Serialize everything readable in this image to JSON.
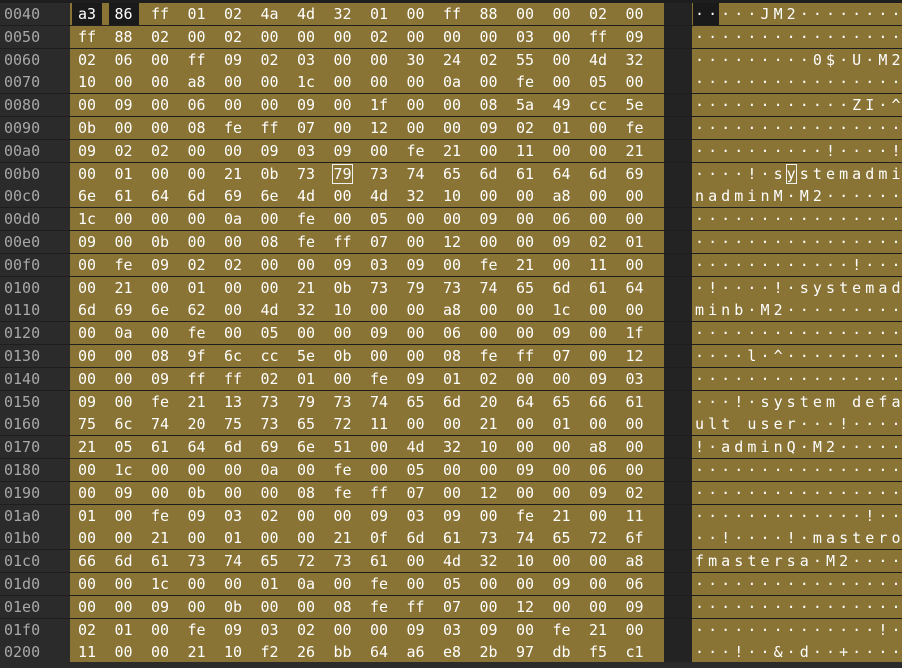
{
  "rows": [
    {
      "addr": "0040",
      "hex": "a3 86 ff 01 02 4a 4d 32 01 00 ff 88 00 00 02 00",
      "ascii": "·····JM2········"
    },
    {
      "addr": "0050",
      "hex": "ff 88 02 00 02 00 00 00 02 00 00 00 03 00 ff 09",
      "ascii": "················"
    },
    {
      "addr": "0060",
      "hex": "02 06 00 ff 09 02 03 00 00 30 24 02 55 00 4d 32",
      "ascii": "·········0$·U·M2"
    },
    {
      "addr": "0070",
      "hex": "10 00 00 a8 00 00 1c 00 00 00 0a 00 fe 00 05 00",
      "ascii": "················"
    },
    {
      "addr": "0080",
      "hex": "00 09 00 06 00 00 09 00 1f 00 00 08 5a 49 cc 5e",
      "ascii": "············ZI·^"
    },
    {
      "addr": "0090",
      "hex": "0b 00 00 08 fe ff 07 00 12 00 00 09 02 01 00 fe",
      "ascii": "················"
    },
    {
      "addr": "00a0",
      "hex": "09 02 02 00 00 09 03 09 00 fe 21 00 11 00 00 21",
      "ascii": "··········!····!"
    },
    {
      "addr": "00b0",
      "hex": "00 01 00 00 21 0b 73 79 73 74 65 6d 61 64 6d 69",
      "ascii": "····!·systemadmi"
    },
    {
      "addr": "00c0",
      "hex": "6e 61 64 6d 69 6e 4d 00 4d 32 10 00 00 a8 00 00",
      "ascii": "nadminM·M2······"
    },
    {
      "addr": "00d0",
      "hex": "1c 00 00 00 0a 00 fe 00 05 00 00 09 00 06 00 00",
      "ascii": "················"
    },
    {
      "addr": "00e0",
      "hex": "09 00 0b 00 00 08 fe ff 07 00 12 00 00 09 02 01",
      "ascii": "················"
    },
    {
      "addr": "00f0",
      "hex": "00 fe 09 02 02 00 00 09 03 09 00 fe 21 00 11 00",
      "ascii": "············!···"
    },
    {
      "addr": "0100",
      "hex": "00 21 00 01 00 00 21 0b 73 79 73 74 65 6d 61 64",
      "ascii": "·!····!·systemad"
    },
    {
      "addr": "0110",
      "hex": "6d 69 6e 62 00 4d 32 10 00 00 a8 00 00 1c 00 00",
      "ascii": "minb·M2·········"
    },
    {
      "addr": "0120",
      "hex": "00 0a 00 fe 00 05 00 00 09 00 06 00 00 09 00 1f",
      "ascii": "················"
    },
    {
      "addr": "0130",
      "hex": "00 00 08 9f 6c cc 5e 0b 00 00 08 fe ff 07 00 12",
      "ascii": "····l·^·········"
    },
    {
      "addr": "0140",
      "hex": "00 00 09 ff ff 02 01 00 fe 09 01 02 00 00 09 03",
      "ascii": "················"
    },
    {
      "addr": "0150",
      "hex": "09 00 fe 21 13 73 79 73 74 65 6d 20 64 65 66 61",
      "ascii": "···!·system defa"
    },
    {
      "addr": "0160",
      "hex": "75 6c 74 20 75 73 65 72 11 00 00 21 00 01 00 00",
      "ascii": "ult user···!····"
    },
    {
      "addr": "0170",
      "hex": "21 05 61 64 6d 69 6e 51 00 4d 32 10 00 00 a8 00",
      "ascii": "!·adminQ·M2·····"
    },
    {
      "addr": "0180",
      "hex": "00 1c 00 00 00 0a 00 fe 00 05 00 00 09 00 06 00",
      "ascii": "················"
    },
    {
      "addr": "0190",
      "hex": "00 09 00 0b 00 00 08 fe ff 07 00 12 00 00 09 02",
      "ascii": "················"
    },
    {
      "addr": "01a0",
      "hex": "01 00 fe 09 03 02 00 00 09 03 09 00 fe 21 00 11",
      "ascii": "·············!··"
    },
    {
      "addr": "01b0",
      "hex": "00 00 21 00 01 00 00 21 0f 6d 61 73 74 65 72 6f",
      "ascii": "··!····!·mastero"
    },
    {
      "addr": "01c0",
      "hex": "66 6d 61 73 74 65 72 73 61 00 4d 32 10 00 00 a8",
      "ascii": "fmastersa·M2····"
    },
    {
      "addr": "01d0",
      "hex": "00 00 1c 00 00 01 0a 00 fe 00 05 00 00 09 00 06",
      "ascii": "················"
    },
    {
      "addr": "01e0",
      "hex": "00 00 09 00 0b 00 00 08 fe ff 07 00 12 00 00 09",
      "ascii": "················"
    },
    {
      "addr": "01f0",
      "hex": "02 01 00 fe 09 03 02 00 00 09 03 09 00 fe 21 00",
      "ascii": "··············!·"
    },
    {
      "addr": "0200",
      "hex": "11 00 00 21 10 f2 26 bb 64 a6 e8 2b 97 db f5 c1",
      "ascii": "···!··&·d··+····"
    }
  ],
  "selection": {
    "unselected_bytes_row0": [
      0,
      1
    ],
    "cursor_row": 7,
    "cursor_col": 7
  },
  "colors": {
    "selection": "#8a7435",
    "background": "#1e1e1e",
    "address_text": "#a8a8a8",
    "text": "#ffffff"
  }
}
